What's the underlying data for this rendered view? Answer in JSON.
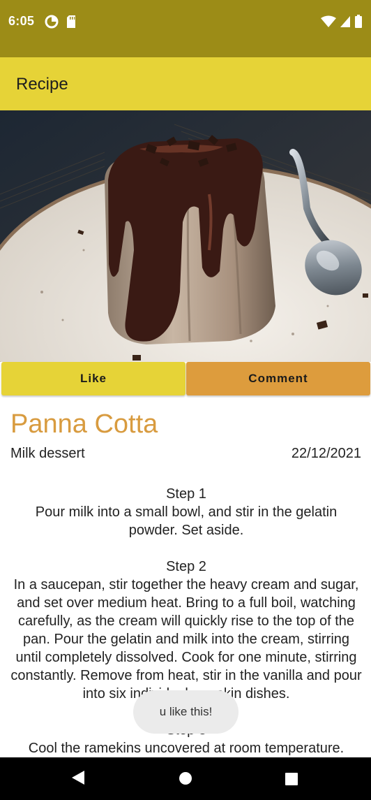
{
  "status_bar": {
    "time": "6:05"
  },
  "app_bar": {
    "title": "Recipe"
  },
  "actions": {
    "like_label": "Like",
    "comment_label": "Comment"
  },
  "recipe": {
    "name": "Panna Cotta",
    "category": "Milk dessert",
    "date": "22/12/2021",
    "steps": [
      {
        "label": "Step 1",
        "text": "Pour milk into a small bowl, and stir in the gelatin powder. Set aside."
      },
      {
        "label": "Step 2",
        "text": "In a saucepan, stir together the heavy cream and sugar, and set over medium heat. Bring to a full boil, watching carefully, as the cream will quickly rise to the top of the pan. Pour the gelatin and milk into the cream, stirring until completely dissolved. Cook for one minute, stirring constantly. Remove from heat, stir in the vanilla and pour into six individual ramekin dishes."
      },
      {
        "label": "Step 3",
        "text": "Cool the ramekins uncovered at room temperature."
      }
    ]
  },
  "toast": {
    "message": "u like this!"
  }
}
